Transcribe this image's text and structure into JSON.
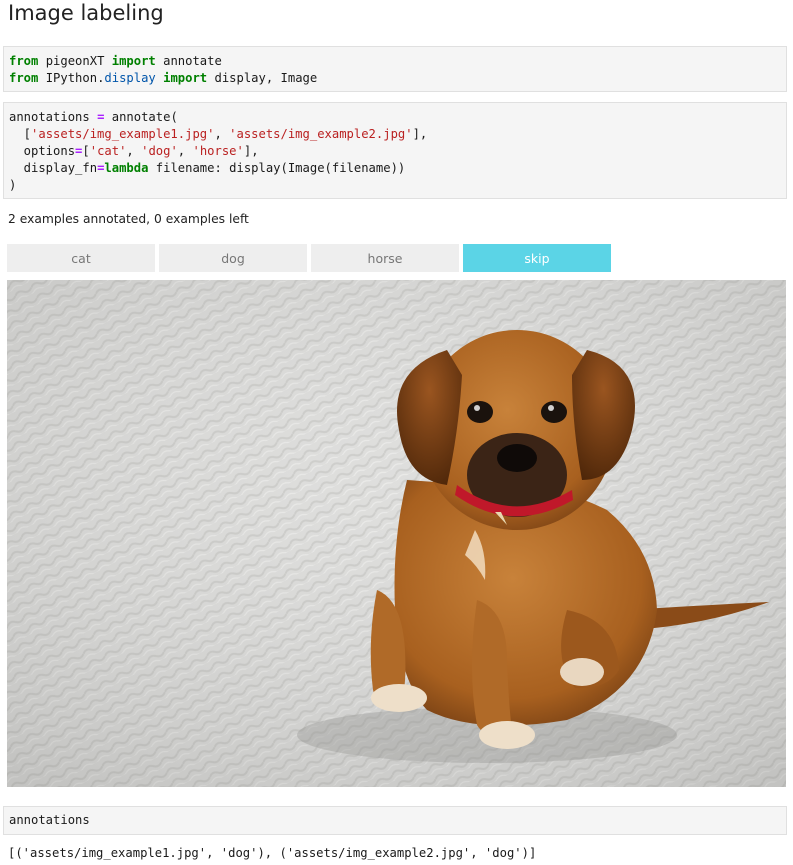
{
  "heading": "Image labeling",
  "cell1": {
    "line1": {
      "kw1": "from",
      "mod": "pigeonXT",
      "kw2": "import",
      "name": "annotate"
    },
    "line2": {
      "kw1": "from",
      "mod_a": "IPython.",
      "mod_b": "display",
      "kw2": "import",
      "names": "display, Image"
    }
  },
  "cell2": {
    "l1_a": "annotations ",
    "l1_op": "=",
    "l1_b": " annotate(",
    "l2_a": "  [",
    "l2_s1": "'assets/img_example1.jpg'",
    "l2_b": ", ",
    "l2_s2": "'assets/img_example2.jpg'",
    "l2_c": "],",
    "l3_a": "  options",
    "l3_op": "=",
    "l3_b": "[",
    "l3_s1": "'cat'",
    "l3_c": ", ",
    "l3_s2": "'dog'",
    "l3_d": ", ",
    "l3_s3": "'horse'",
    "l3_e": "],",
    "l4_a": "  display_fn",
    "l4_op": "=",
    "l4_kw": "lambda",
    "l4_b": " filename: display(Image(filename))",
    "l5": ")"
  },
  "status": "2 examples annotated, 0 examples left",
  "buttons": [
    {
      "label": "cat"
    },
    {
      "label": "dog"
    },
    {
      "label": "horse"
    },
    {
      "label": "skip"
    }
  ],
  "colors": {
    "skip_button": "#5bd4e6",
    "button_bg": "#eeeeee",
    "keyword": "#008000",
    "string": "#ba2121"
  },
  "image": {
    "subject": "puppy sitting on a gray knitted rug"
  },
  "cell3": {
    "code": "annotations"
  },
  "result": "[('assets/img_example1.jpg', 'dog'), ('assets/img_example2.jpg', 'dog')]"
}
